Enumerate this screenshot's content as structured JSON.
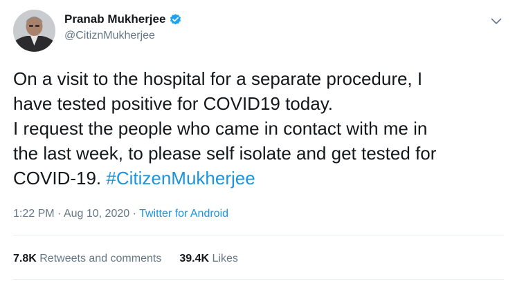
{
  "author": {
    "display_name": "Pranab Mukherjee",
    "handle": "@CitiznMukherjee",
    "verified": true,
    "avatar_icon": "profile-photo"
  },
  "tweet": {
    "lines": [
      "On a visit to the hospital for a separate procedure, I",
      "have tested positive for COVID19 today.",
      "I request the people who came in contact with me in",
      "the last week, to please self isolate and get tested for"
    ],
    "last_line_text": "COVID-19. ",
    "hashtag": "#CitizenMukherjee"
  },
  "meta": {
    "time": "1:22 PM",
    "separator": "·",
    "date": "Aug 10, 2020",
    "source": "Twitter for Android"
  },
  "stats": {
    "retweets_count": "7.8K",
    "retweets_label": "Retweets and comments",
    "likes_count": "39.4K",
    "likes_label": "Likes"
  },
  "colors": {
    "link": "#1b95e0",
    "secondary_text": "#657786",
    "primary_text": "#14171a",
    "verified_badge": "#1da1f2"
  },
  "icons": {
    "caret": "chevron-down-icon",
    "verified": "verified-badge-icon"
  }
}
